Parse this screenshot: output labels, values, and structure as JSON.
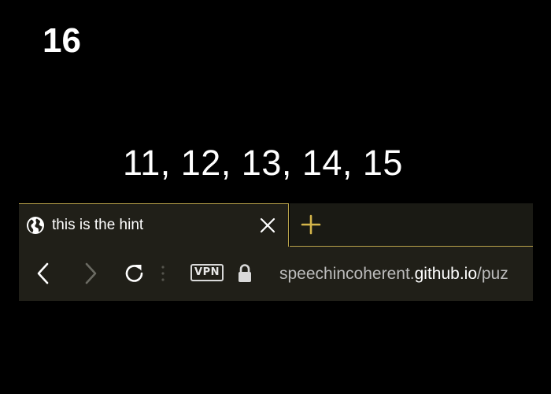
{
  "level_number": "16",
  "sequence": "11, 12, 13, 14, 15",
  "browser": {
    "tab": {
      "title": "this is the hint",
      "favicon": "globe-icon",
      "close_icon": "close-icon"
    },
    "new_tab_icon": "plus-icon",
    "toolbar": {
      "back_icon": "chevron-left-icon",
      "forward_icon": "chevron-right-icon",
      "reload_icon": "reload-icon",
      "vpn_label": "VPN",
      "lock_icon": "lock-icon",
      "url": {
        "subdomain": "speechincoherent.",
        "domain": "github.io",
        "path": "/puz"
      }
    },
    "accent_color": "#b8a24a"
  }
}
